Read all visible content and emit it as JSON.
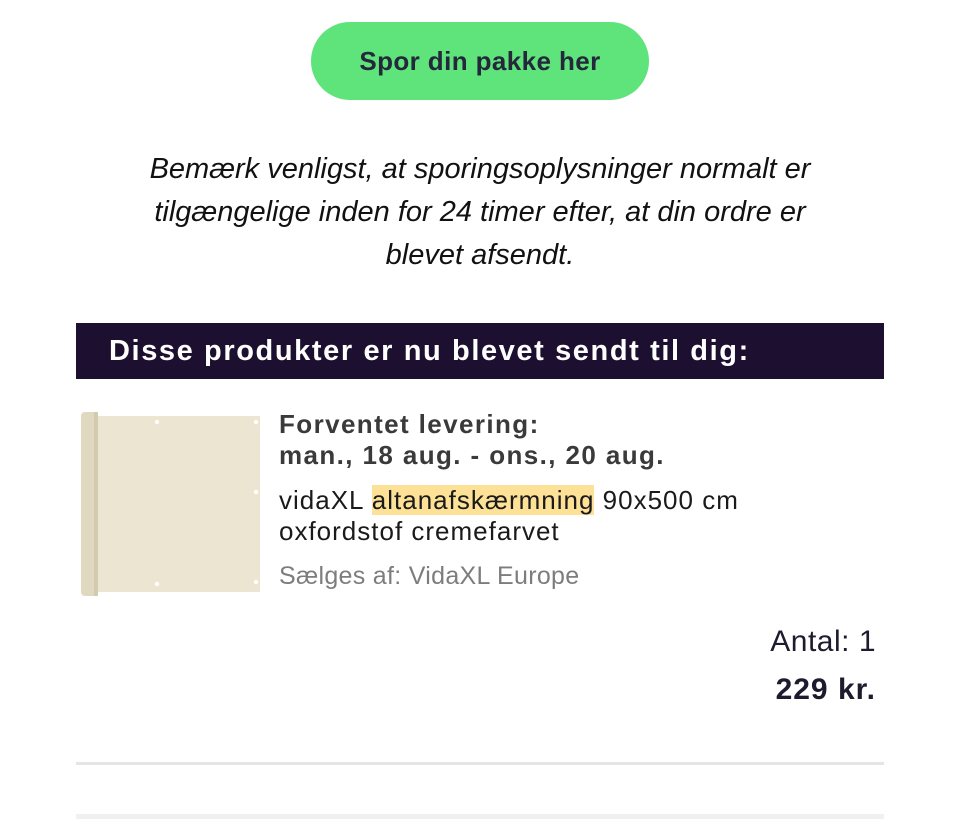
{
  "track_button": {
    "label": "Spor din pakke her",
    "color": "#5ee47a"
  },
  "notice": {
    "line1": "Bemærk venligst, at sporingsoplysninger normalt er",
    "line2": "tilgængelige inden for 24 timer efter, at din ordre er",
    "line3": "blevet afsendt."
  },
  "banner": {
    "title": "Disse produkter er nu blevet sendt til dig:",
    "color": "#1c0f30"
  },
  "product": {
    "image_icon": "cream-balcony-screen-image",
    "delivery_label": "Forventet levering:",
    "delivery_dates": "man., 18 aug. - ons., 20 aug.",
    "title_before": "vidaXL",
    "title_highlight": "altanafskærmning",
    "title_after": "90x500 cm",
    "title_line2": "oxfordstof cremefarvet",
    "seller": "Sælges af: VidaXL Europe",
    "quantity_label": "Antal:",
    "quantity": "1",
    "price": "229 kr."
  }
}
